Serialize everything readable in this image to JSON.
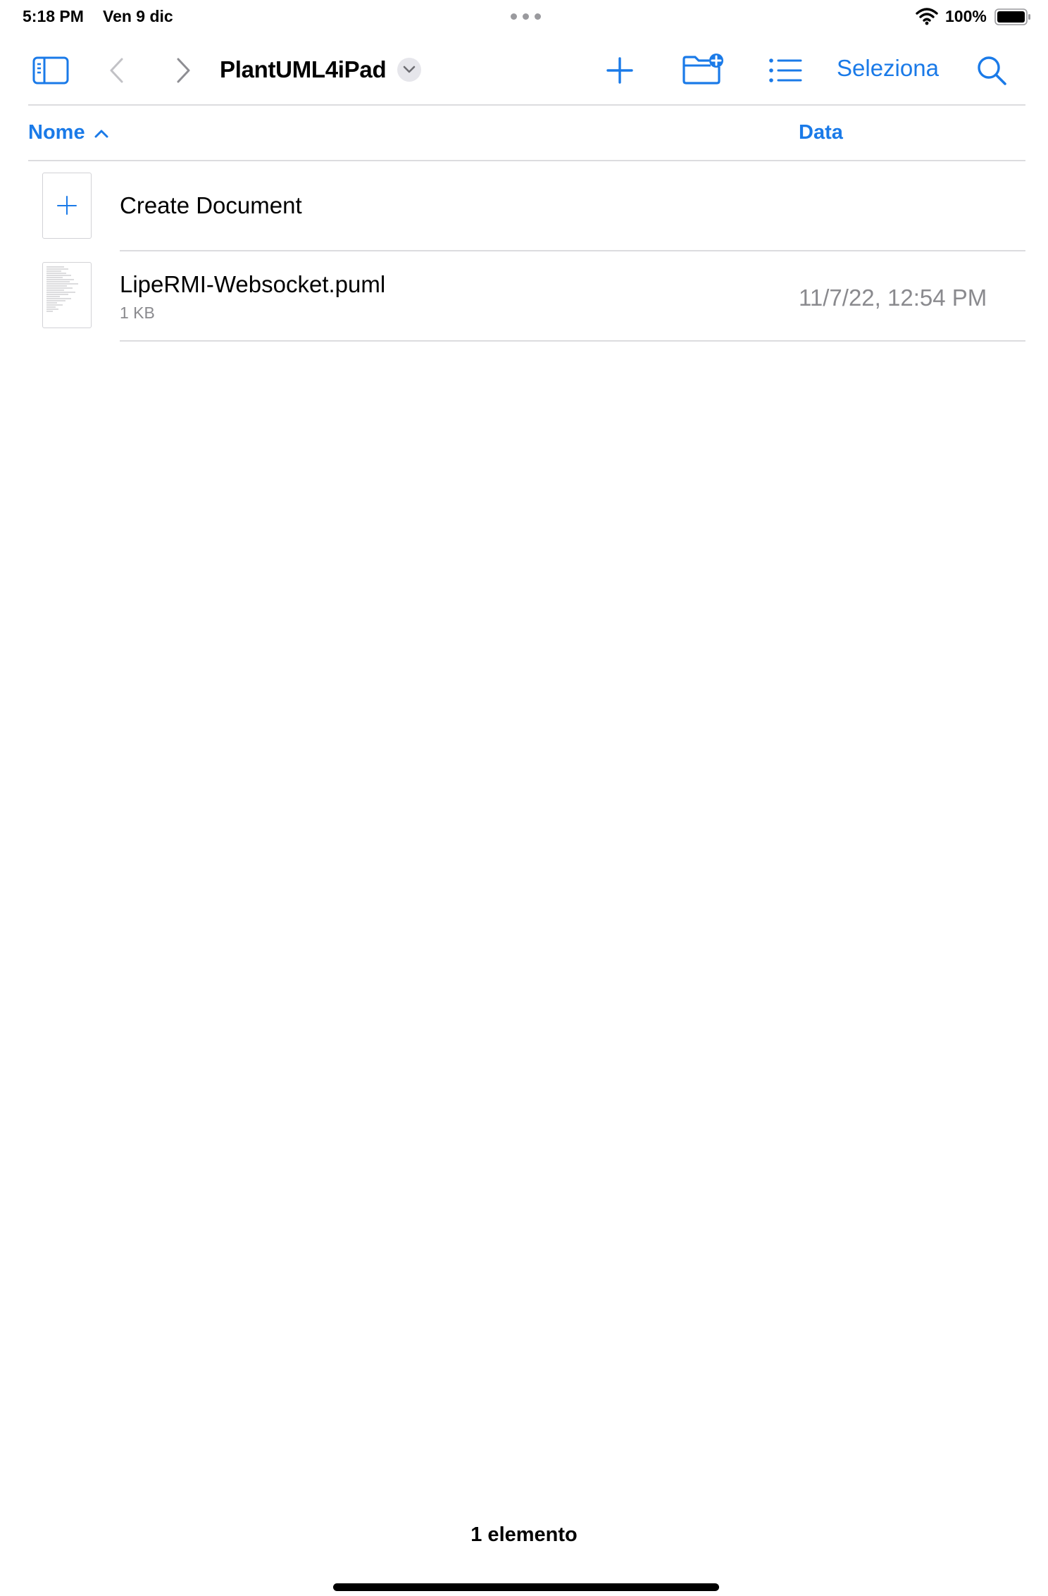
{
  "status_bar": {
    "time": "5:18 PM",
    "date": "Ven 9 dic",
    "battery_percent": "100%",
    "wifi_icon": "wifi-icon",
    "battery_icon": "battery-full-icon"
  },
  "toolbar": {
    "sidebar_icon": "sidebar-toggle-icon",
    "back_icon": "chevron-left-icon",
    "forward_icon": "chevron-right-icon",
    "title": "PlantUML4iPad",
    "title_menu_icon": "chevron-down-icon",
    "add_icon": "plus-icon",
    "new_folder_icon": "folder-badge-plus-icon",
    "view_icon": "list-icon",
    "select_label": "Seleziona",
    "search_icon": "magnifying-glass-icon"
  },
  "columns": {
    "name_header": "Nome",
    "name_sort_icon": "chevron-up-icon",
    "date_header": "Data"
  },
  "rows": {
    "create_label": "Create Document",
    "create_icon": "plus-icon",
    "files": [
      {
        "name": "LipeRMI-Websocket.puml",
        "size": "1 KB",
        "date": "11/7/22, 12:54 PM"
      }
    ]
  },
  "footer": {
    "item_count": "1 elemento"
  },
  "colors": {
    "accent": "#1a7ae8",
    "secondary_text": "#8a8a8e",
    "divider": "#dcdcdf"
  }
}
